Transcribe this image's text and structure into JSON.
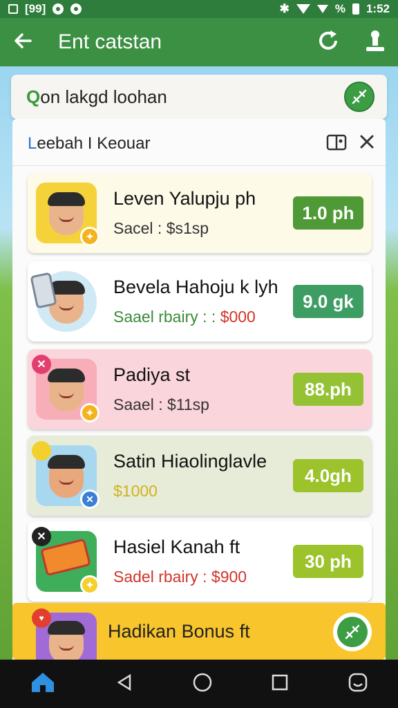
{
  "status_bar": {
    "left_text": "[99]",
    "time": "1:52",
    "signal_text": "%"
  },
  "app_bar": {
    "title": "Ent catstan"
  },
  "search": {
    "text_lead": "Q",
    "text_rest": "on lakgd loohan"
  },
  "filter": {
    "text_lead": "L",
    "text_rest": "eebah I Keouar"
  },
  "items": [
    {
      "name": "Leven Yalupju ph",
      "sub": "Sacel : $s1sp",
      "sub_parts": [
        "",
        ""
      ],
      "price": "1.0 ph",
      "price_color": "#4f9a36",
      "bg": "#fdfae8",
      "avatar_bg": "#f6d23a",
      "badge_color": "#f4b21c"
    },
    {
      "name": "Bevela Hahoju k lyh",
      "sub_lead": "Saael rbairy : : ",
      "sub_tail": "$000",
      "price": "9.0 gk",
      "price_color": "#3e9d62",
      "bg": "#ffffff",
      "avatar_bg": "#cfe9f5",
      "badge_color": "#e7572d"
    },
    {
      "name": "Padiya st",
      "sub": "Saael : $11sp",
      "price": "88.ph",
      "price_color": "#94c234",
      "bg": "#fbd5dc",
      "avatar_bg": "#f7aeb8",
      "badge_color": "#f4b21c",
      "corner_color": "#e23f6f",
      "corner_glyph": "✕"
    },
    {
      "name": "Satin Hiaolinglavle",
      "sub": "$1000",
      "price": "4.0gh",
      "price_color": "#9cc22c",
      "bg": "#e6ecd8",
      "avatar_bg": "#a8d8f0",
      "badge_color": "#3a7fd6",
      "corner_color": "#f4d02c",
      "corner_glyph": ""
    },
    {
      "name": "Hasiel Kanah ft",
      "sub": "Sadel rbairy : $900",
      "price": "30 ph",
      "price_color": "#9cc22c",
      "bg": "#ffffff",
      "avatar_bg": "#3fae5a",
      "badge_color": "#f4d02c",
      "corner_color": "#222222",
      "corner_glyph": "✕"
    }
  ],
  "bonus": {
    "title": "Hadikan Bonus ft"
  },
  "colors": {
    "primary": "#3b9043",
    "status": "#2f7d3c",
    "accent_yellow": "#f8c52d"
  },
  "icons": [
    "back-arrow-icon",
    "refresh-icon",
    "download-icon",
    "link-icon",
    "camera-folder-icon",
    "close-icon",
    "home-icon",
    "back-triangle-icon",
    "circle-home-icon",
    "recents-square-icon",
    "assistant-icon"
  ]
}
